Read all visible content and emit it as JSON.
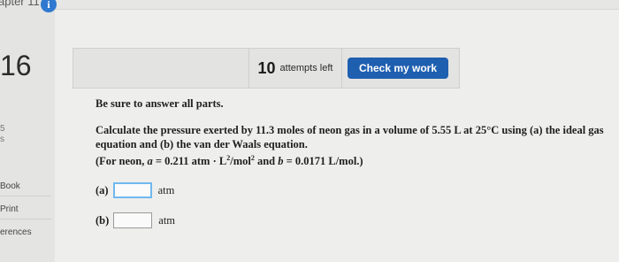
{
  "sidebar": {
    "chapter_label": "apter 11",
    "info_glyph": "i",
    "question_number": "16",
    "small_5": "5",
    "small_s": "s",
    "links": [
      {
        "label": "Book"
      },
      {
        "label": "Print"
      },
      {
        "label": "erences"
      }
    ]
  },
  "header": {
    "attempts_number": "10",
    "attempts_label": "attempts left",
    "check_button_label": "Check my work"
  },
  "question": {
    "instruction": "Be sure to answer all parts.",
    "text_main": "Calculate the pressure exerted by 11.3 moles of neon gas in a volume of 5.55 L at 25°C using (a) the ideal gas equation and (b) the van der Waals equation.",
    "text_constants_prefix": "(For neon, ",
    "a_var": "a",
    "a_value": " = 0.211 atm · L",
    "a_exp": "2",
    "a_unit_tail": "/mol",
    "a_unit_exp": "2",
    "and_text": " and ",
    "b_var": "b",
    "b_value": " = 0.0171 L/mol.)",
    "parts": [
      {
        "label": "(a)",
        "value": "",
        "unit": "atm"
      },
      {
        "label": "(b)",
        "value": "",
        "unit": "atm"
      }
    ]
  },
  "colors": {
    "accent_button": "#1f5fb0",
    "info_icon": "#2f79d0",
    "input_focus": "#6fb8ef"
  }
}
